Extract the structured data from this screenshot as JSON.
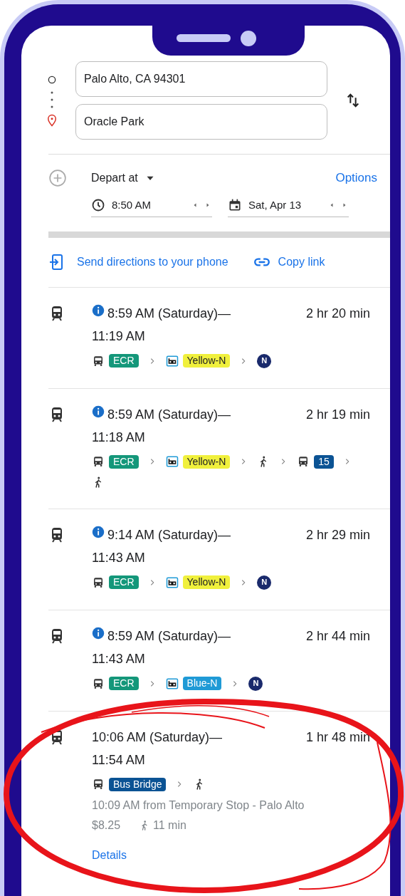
{
  "route": {
    "origin": "Palo Alto, CA 94301",
    "destination": "Oracle Park"
  },
  "when": {
    "mode": "Depart at",
    "options": "Options",
    "time": "8:50 AM",
    "date": "Sat, Apr 13"
  },
  "share": {
    "send": "Send directions to your phone",
    "copy": "Copy link"
  },
  "trips": [
    {
      "info": true,
      "depart": "8:59 AM (Saturday)—",
      "arrive": "11:19 AM",
      "duration": "2 hr 20 min",
      "legs": [
        {
          "kind": "bus",
          "label": "ECR",
          "color": "#14977a"
        },
        {
          "kind": "rail",
          "label": "Yellow-N",
          "color": "#f0f03c"
        },
        {
          "kind": "circle",
          "label": "N",
          "color": "#1a2a6c"
        }
      ]
    },
    {
      "info": true,
      "depart": "8:59 AM (Saturday)—",
      "arrive": "11:18 AM",
      "duration": "2 hr 19 min",
      "legs": [
        {
          "kind": "bus",
          "label": "ECR",
          "color": "#14977a"
        },
        {
          "kind": "rail",
          "label": "Yellow-N",
          "color": "#f0f03c"
        },
        {
          "kind": "walk"
        },
        {
          "kind": "bus",
          "label": "15",
          "color": "#0b5394"
        },
        {
          "kind": "walk"
        }
      ]
    },
    {
      "info": true,
      "depart": "9:14 AM (Saturday)—",
      "arrive": "11:43 AM",
      "duration": "2 hr 29 min",
      "legs": [
        {
          "kind": "bus",
          "label": "ECR",
          "color": "#14977a"
        },
        {
          "kind": "rail",
          "label": "Yellow-N",
          "color": "#f0f03c"
        },
        {
          "kind": "circle",
          "label": "N",
          "color": "#1a2a6c"
        }
      ]
    },
    {
      "info": true,
      "depart": "8:59 AM (Saturday)—",
      "arrive": "11:43 AM",
      "duration": "2 hr 44 min",
      "legs": [
        {
          "kind": "bus",
          "label": "ECR",
          "color": "#14977a"
        },
        {
          "kind": "rail",
          "label": "Blue-N",
          "color": "#1f9ad6"
        },
        {
          "kind": "circle",
          "label": "N",
          "color": "#1a2a6c"
        }
      ]
    },
    {
      "info": false,
      "depart": "10:06 AM (Saturday)—",
      "arrive": "11:54 AM",
      "duration": "1 hr 48 min",
      "legs": [
        {
          "kind": "bus",
          "label": "Bus Bridge",
          "color": "#0b5394"
        },
        {
          "kind": "walk"
        }
      ],
      "from": "10:09 AM from Temporary Stop - Palo Alto",
      "fare": "$8.25",
      "walk": "11 min",
      "details": "Details"
    }
  ]
}
